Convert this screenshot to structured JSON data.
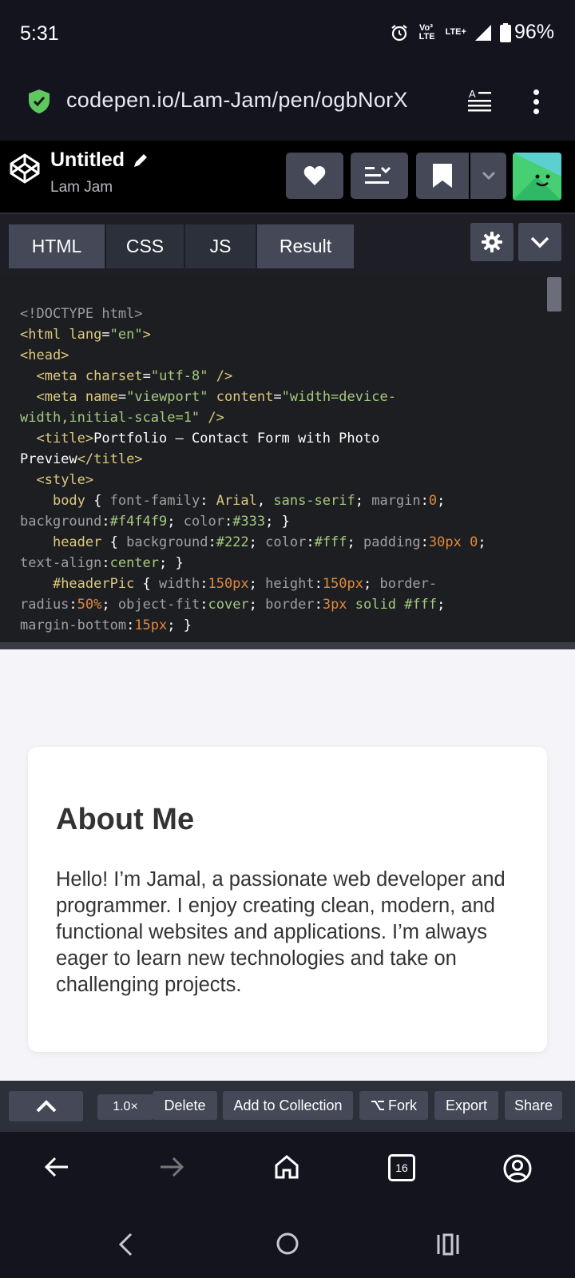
{
  "status": {
    "time": "5:31",
    "volte": "Vo³ LTE",
    "lte": "LTE+",
    "battery": "96%"
  },
  "browser": {
    "url": "codepen.io/Lam-Jam/pen/ogbNorX"
  },
  "pen": {
    "title": "Untitled",
    "author": "Lam Jam"
  },
  "tabs": [
    "HTML",
    "CSS",
    "JS",
    "Result"
  ],
  "preview": {
    "heading": "About Me",
    "paragraph": "Hello! I’m Jamal, a passionate web developer and programmer. I enjoy creating clean, modern, and functional websites and applications. I’m always eager to learn new technologies and take on challenging projects."
  },
  "footer": {
    "zoom": "1.0×",
    "delete": "Delete",
    "add_to_collection": "Add to Collection",
    "fork": "Fork",
    "export": "Export",
    "share": "Share"
  },
  "nav": {
    "tab_count": "16"
  },
  "colors": {
    "shield": "#5ec75e",
    "accent_orange": "#e0883b",
    "avatar_green": "#47cf73"
  }
}
